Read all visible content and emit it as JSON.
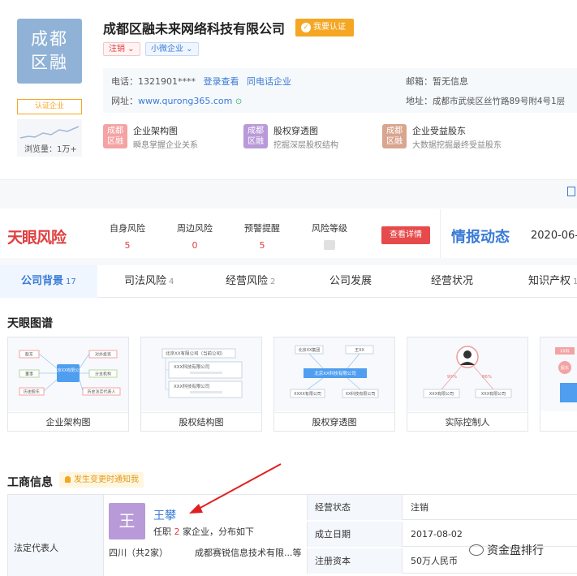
{
  "header": {
    "logo_text": "成都区融",
    "company_name": "成都区融未来网络科技有限公司",
    "claim_label": "我要认证",
    "tags": [
      "注销",
      "小微企业"
    ],
    "auth_badge": "认证企业",
    "views_label": "浏览量：1万+"
  },
  "contact": {
    "phone_label": "电话：",
    "phone": "1321901****",
    "login_link": "登录查看",
    "same_phone_link": "同电话企业",
    "email_label": "邮箱：",
    "email": "暂无信息",
    "website_label": "网址：",
    "website": "www.qurong365.com",
    "address_label": "地址：",
    "address": "成都市武侯区丝竹路89号附4号1层"
  },
  "features": [
    {
      "icon_text": "成都区融",
      "title": "企业架构图",
      "desc": "瞬息掌握企业关系",
      "color": "#f4a3a3"
    },
    {
      "icon_text": "成都区融",
      "title": "股权穿透图",
      "desc": "挖掘深层股权结构",
      "color": "#b99ad8"
    },
    {
      "icon_text": "成都区融",
      "title": "企业受益股东",
      "desc": "大数据挖掘最终受益股东",
      "color": "#d9a58f"
    }
  ],
  "risk": {
    "logo": "天眼风险",
    "items": [
      {
        "label": "自身风险",
        "value": "5"
      },
      {
        "label": "周边风险",
        "value": "0"
      },
      {
        "label": "预警提醒",
        "value": "5"
      },
      {
        "label": "风险等级",
        "value": ""
      }
    ],
    "detail_button": "查看详情",
    "intel_title": "情报动态",
    "intel_date": "2020-06-"
  },
  "tabs": [
    {
      "label": "公司背景",
      "count": "17"
    },
    {
      "label": "司法风险",
      "count": "4"
    },
    {
      "label": "经营风险",
      "count": "2"
    },
    {
      "label": "公司发展",
      "count": ""
    },
    {
      "label": "经营状况",
      "count": ""
    },
    {
      "label": "知识产权",
      "count": "1"
    }
  ],
  "graph_section": {
    "title": "天眼图谱",
    "cards": [
      "企业架构图",
      "股权结构图",
      "股权穿透图",
      "实际控制人"
    ],
    "card1_nodes": [
      "北京XX有限公司",
      "股东",
      "对外投资",
      "董事",
      "分支机构",
      "历史股东",
      "历史法定代表人"
    ],
    "card2_nodes": [
      "北京XX有限公司（当前公司）",
      "XXX科技有限公司",
      "XXX科技有限公司"
    ],
    "card3_nodes": [
      "北京XX集团",
      "王XX",
      "北京XX科技有限公司",
      "XXXX有限公司",
      "XX科技有限公司"
    ],
    "card4_nodes": [
      "99%",
      "86%",
      "XXX有限公司",
      "XXX有限公司"
    ],
    "card5_nodes": [
      "XX科",
      "股东"
    ]
  },
  "business": {
    "title": "工商信息",
    "notify": "发生变更时通知我",
    "legal_rep_label": "法定代表人",
    "avatar_text": "王",
    "rep_name": "王攀",
    "rep_info_pre": "任职",
    "rep_info_count": "2",
    "rep_info_post": "家企业，分布如下",
    "rep_region": "四川（共2家）",
    "rep_company": "成都赛锐信息技术有限...等",
    "rows": [
      {
        "key": "经营状态",
        "value": "注销"
      },
      {
        "key": "成立日期",
        "value": "2017-08-02"
      },
      {
        "key": "注册资本",
        "value": "50万人民币"
      }
    ]
  },
  "watermark": "资金盘排行"
}
